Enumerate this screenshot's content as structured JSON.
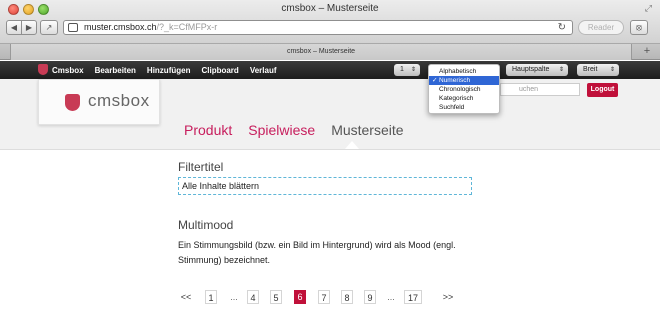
{
  "window": {
    "title": "cmsbox – Musterseite"
  },
  "browser": {
    "url_host": "muster.cmsbox.ch",
    "url_path": "/?_k=CfMFPx-r",
    "reader_label": "Reader",
    "tab_title": "cmsbox – Musterseite",
    "new_tab_label": "+"
  },
  "cms_toolbar": {
    "items": [
      "Cmsbox",
      "Bearbeiten",
      "Hinzufügen",
      "Clipboard",
      "Verlauf"
    ],
    "select_number": "1",
    "select_column": "Hauptspalte",
    "select_width": "Breit"
  },
  "dropdown": {
    "options": [
      "Alphabetisch",
      "Numerisch",
      "Chronologisch",
      "Kategorisch",
      "Suchfeld"
    ],
    "selected_index": 1,
    "check": "✓"
  },
  "site": {
    "logo_text": "cmsbox",
    "search_placeholder": "uchen",
    "logout_label": "Logout",
    "nav": [
      "Produkt",
      "Spielwiese",
      "Musterseite"
    ],
    "active_nav": "Musterseite"
  },
  "content": {
    "filter_title": "Filtertitel",
    "filter_text": "Alle Inhalte blättern",
    "mood_title": "Multimood",
    "mood_text": "Ein Stimmungsbild (bzw. ein Bild im Hintergrund) wird als Mood (engl. Stimmung) bezeichnet."
  },
  "pager": {
    "prev": "<<",
    "pages": [
      "1",
      "...",
      "4",
      "5",
      "6",
      "7",
      "8",
      "9",
      "...",
      "17"
    ],
    "current": "6",
    "next": ">>"
  },
  "colors": {
    "accent": "#c71e5d",
    "logout": "#c0103a",
    "dropdown_highlight": "#2f66d5",
    "dashed": "#5fb6d8"
  }
}
